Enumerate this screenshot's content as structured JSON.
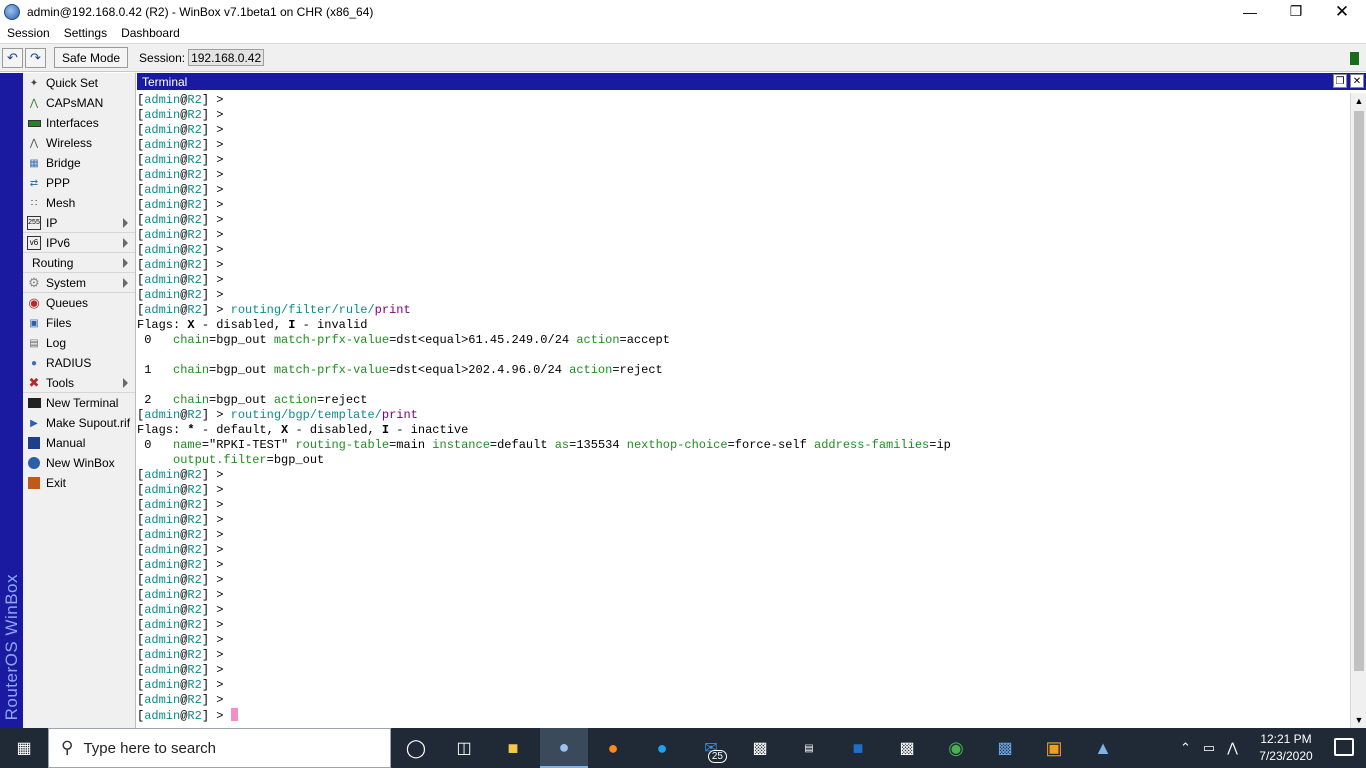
{
  "window": {
    "title": "admin@192.168.0.42 (R2) - WinBox v7.1beta1 on CHR (x86_64)",
    "controls": [
      "minimize",
      "restore",
      "close"
    ]
  },
  "menubar": {
    "items": [
      "Session",
      "Settings",
      "Dashboard"
    ]
  },
  "toolbar": {
    "undo_icon": "undo-icon",
    "redo_icon": "redo-icon",
    "safe_mode_label": "Safe Mode",
    "session_label": "Session:",
    "session_value": "192.168.0.42"
  },
  "brand": "RouterOS WinBox",
  "sidebar": {
    "items": [
      {
        "label": "Quick Set",
        "icon": "wand-icon",
        "submenu": false
      },
      {
        "label": "CAPsMAN",
        "icon": "capsman-icon",
        "submenu": false
      },
      {
        "label": "Interfaces",
        "icon": "interfaces-icon",
        "submenu": false
      },
      {
        "label": "Wireless",
        "icon": "wireless-icon",
        "submenu": false
      },
      {
        "label": "Bridge",
        "icon": "bridge-icon",
        "submenu": false
      },
      {
        "label": "PPP",
        "icon": "ppp-icon",
        "submenu": false
      },
      {
        "label": "Mesh",
        "icon": "mesh-icon",
        "submenu": false
      },
      {
        "label": "IP",
        "icon": "ip-icon",
        "submenu": true
      },
      {
        "label": "IPv6",
        "icon": "ipv6-icon",
        "submenu": true
      },
      {
        "label": "Routing",
        "icon": "",
        "submenu": true
      },
      {
        "label": "System",
        "icon": "gear-icon",
        "submenu": true
      },
      {
        "label": "Queues",
        "icon": "queues-icon",
        "submenu": false
      },
      {
        "label": "Files",
        "icon": "folder-icon",
        "submenu": false
      },
      {
        "label": "Log",
        "icon": "log-icon",
        "submenu": false
      },
      {
        "label": "RADIUS",
        "icon": "radius-icon",
        "submenu": false
      },
      {
        "label": "Tools",
        "icon": "tools-icon",
        "submenu": true
      },
      {
        "label": "New Terminal",
        "icon": "terminal-icon",
        "submenu": false
      },
      {
        "label": "Make Supout.rif",
        "icon": "supout-icon",
        "submenu": false
      },
      {
        "label": "Manual",
        "icon": "manual-icon",
        "submenu": false
      },
      {
        "label": "New WinBox",
        "icon": "winbox-icon",
        "submenu": false
      },
      {
        "label": "Exit",
        "icon": "exit-icon",
        "submenu": false
      }
    ]
  },
  "terminal": {
    "title": "Terminal",
    "prompt": {
      "open": "[",
      "user": "admin",
      "at": "@",
      "host": "R2",
      "close": "]",
      "gt": " > "
    },
    "lines": [
      {
        "t": "prompt"
      },
      {
        "t": "prompt"
      },
      {
        "t": "prompt"
      },
      {
        "t": "prompt"
      },
      {
        "t": "prompt"
      },
      {
        "t": "prompt"
      },
      {
        "t": "prompt"
      },
      {
        "t": "prompt"
      },
      {
        "t": "prompt"
      },
      {
        "t": "prompt"
      },
      {
        "t": "prompt"
      },
      {
        "t": "prompt"
      },
      {
        "t": "prompt"
      },
      {
        "t": "prompt"
      },
      {
        "t": "cmd",
        "path": "routing/filter/rule/",
        "action": "print"
      },
      {
        "t": "flags",
        "parts": [
          [
            "n",
            "Flags: "
          ],
          [
            "b",
            "X"
          ],
          [
            "n",
            " - disabled, "
          ],
          [
            "b",
            "I"
          ],
          [
            "n",
            " - invalid"
          ]
        ]
      },
      {
        "t": "entry",
        "idx": " 0   ",
        "pairs": [
          [
            "chain",
            "bgp_out"
          ],
          [
            "match-prfx-value",
            "dst<equal>61.45.249.0/24"
          ],
          [
            "action",
            "accept"
          ]
        ]
      },
      {
        "t": "blank"
      },
      {
        "t": "entry",
        "idx": " 1   ",
        "pairs": [
          [
            "chain",
            "bgp_out"
          ],
          [
            "match-prfx-value",
            "dst<equal>202.4.96.0/24"
          ],
          [
            "action",
            "reject"
          ]
        ]
      },
      {
        "t": "blank"
      },
      {
        "t": "entry",
        "idx": " 2   ",
        "pairs": [
          [
            "chain",
            "bgp_out"
          ],
          [
            "action",
            "reject"
          ]
        ]
      },
      {
        "t": "cmd",
        "path": "routing/bgp/template/",
        "action": "print"
      },
      {
        "t": "flags",
        "parts": [
          [
            "n",
            "Flags: "
          ],
          [
            "b",
            "*"
          ],
          [
            "n",
            " - default, "
          ],
          [
            "b",
            "X"
          ],
          [
            "n",
            " - disabled, "
          ],
          [
            "b",
            "I"
          ],
          [
            "n",
            " - inactive"
          ]
        ]
      },
      {
        "t": "entry",
        "idx": " 0   ",
        "pairs": [
          [
            "name",
            "\"RPKI-TEST\""
          ],
          [
            "routing-table",
            "main"
          ],
          [
            "instance",
            "default"
          ],
          [
            "as",
            "135534"
          ],
          [
            "nexthop-choice",
            "force-self"
          ],
          [
            "address-families",
            "ip"
          ]
        ]
      },
      {
        "t": "entry",
        "idx": "     ",
        "pairs": [
          [
            "output.filter",
            "bgp_out"
          ]
        ]
      },
      {
        "t": "prompt"
      },
      {
        "t": "prompt"
      },
      {
        "t": "prompt"
      },
      {
        "t": "prompt"
      },
      {
        "t": "prompt"
      },
      {
        "t": "prompt"
      },
      {
        "t": "prompt"
      },
      {
        "t": "prompt"
      },
      {
        "t": "prompt"
      },
      {
        "t": "prompt"
      },
      {
        "t": "prompt"
      },
      {
        "t": "prompt"
      },
      {
        "t": "prompt"
      },
      {
        "t": "prompt"
      },
      {
        "t": "prompt"
      },
      {
        "t": "prompt"
      },
      {
        "t": "prompt_cursor"
      }
    ]
  },
  "taskbar": {
    "search_placeholder": "Type here to search",
    "mail_badge": "25",
    "clock_time": "12:21 PM",
    "clock_date": "7/23/2020"
  }
}
